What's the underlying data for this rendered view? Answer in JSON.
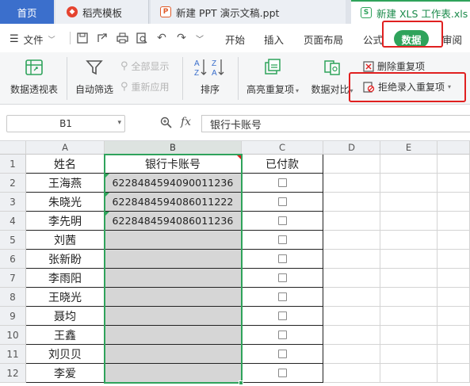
{
  "tabs": [
    {
      "label": "首页"
    },
    {
      "label": "稻壳模板"
    },
    {
      "label": "新建 PPT 演示文稿.ppt"
    },
    {
      "label": "新建 XLS 工作表.xls"
    }
  ],
  "menu": {
    "file_label": "文件",
    "items": [
      "开始",
      "插入",
      "页面布局",
      "公式",
      "数据",
      "审阅"
    ],
    "active": "数据"
  },
  "ribbon": {
    "pivot_label": "数据透视表",
    "autofilter_label": "自动筛选",
    "show_all_label": "全部显示",
    "reapply_label": "重新应用",
    "sort_label": "排序",
    "highlight_dup_label": "高亮重复项",
    "compare_label": "数据对比",
    "delete_dup_label": "删除重复项",
    "reject_dup_label": "拒绝录入重复项"
  },
  "formula_bar": {
    "name_box": "B1",
    "fx_label": "fx",
    "content": "银行卡账号"
  },
  "sheet": {
    "columns": [
      "A",
      "B",
      "C",
      "D",
      "E"
    ],
    "rows": [
      {
        "num": "1",
        "a": "姓名",
        "b": "银行卡账号",
        "c": "已付款"
      },
      {
        "num": "2",
        "a": "王海燕",
        "b": "6228484594090011236"
      },
      {
        "num": "3",
        "a": "朱晓光",
        "b": "6228484594086011222"
      },
      {
        "num": "4",
        "a": "李先明",
        "b": "6228484594086011236"
      },
      {
        "num": "5",
        "a": "刘茜",
        "b": ""
      },
      {
        "num": "6",
        "a": "张新盼",
        "b": ""
      },
      {
        "num": "7",
        "a": "李雨阳",
        "b": ""
      },
      {
        "num": "8",
        "a": "王晓光",
        "b": ""
      },
      {
        "num": "9",
        "a": "聂均",
        "b": ""
      },
      {
        "num": "10",
        "a": "王鑫",
        "b": ""
      },
      {
        "num": "11",
        "a": "刘贝贝",
        "b": ""
      },
      {
        "num": "12",
        "a": "李爱",
        "b": ""
      }
    ]
  },
  "colors": {
    "accent_green": "#2fa35b",
    "highlight_red": "#e02020",
    "home_tab": "#3b6fcc"
  }
}
